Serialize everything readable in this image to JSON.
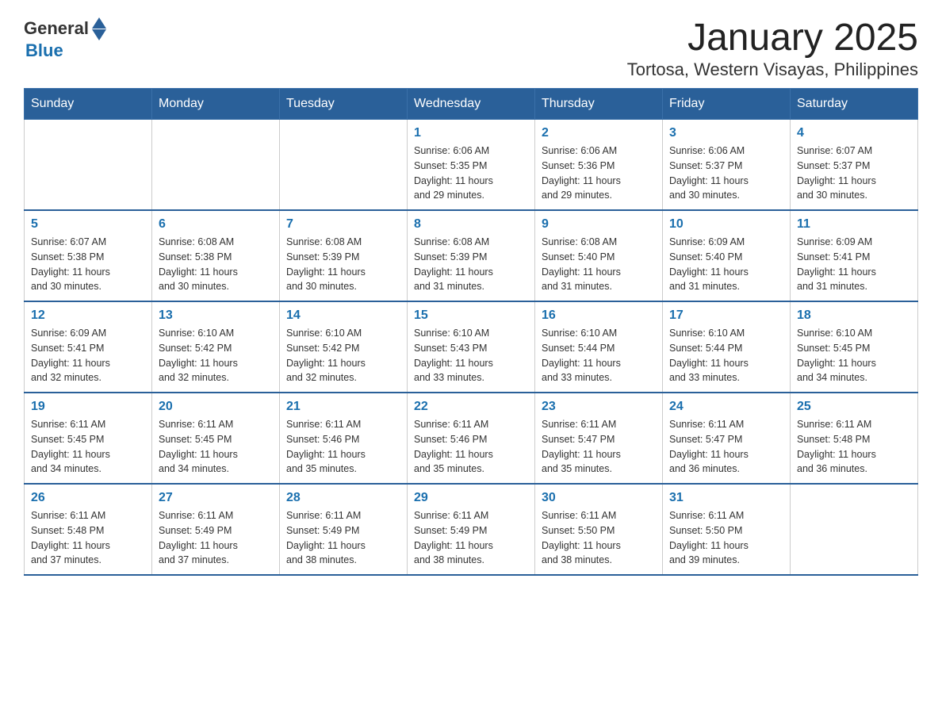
{
  "logo": {
    "text_general": "General",
    "text_blue": "Blue"
  },
  "title": "January 2025",
  "subtitle": "Tortosa, Western Visayas, Philippines",
  "headers": [
    "Sunday",
    "Monday",
    "Tuesday",
    "Wednesday",
    "Thursday",
    "Friday",
    "Saturday"
  ],
  "weeks": [
    [
      {
        "day": "",
        "info": ""
      },
      {
        "day": "",
        "info": ""
      },
      {
        "day": "",
        "info": ""
      },
      {
        "day": "1",
        "info": "Sunrise: 6:06 AM\nSunset: 5:35 PM\nDaylight: 11 hours\nand 29 minutes."
      },
      {
        "day": "2",
        "info": "Sunrise: 6:06 AM\nSunset: 5:36 PM\nDaylight: 11 hours\nand 29 minutes."
      },
      {
        "day": "3",
        "info": "Sunrise: 6:06 AM\nSunset: 5:37 PM\nDaylight: 11 hours\nand 30 minutes."
      },
      {
        "day": "4",
        "info": "Sunrise: 6:07 AM\nSunset: 5:37 PM\nDaylight: 11 hours\nand 30 minutes."
      }
    ],
    [
      {
        "day": "5",
        "info": "Sunrise: 6:07 AM\nSunset: 5:38 PM\nDaylight: 11 hours\nand 30 minutes."
      },
      {
        "day": "6",
        "info": "Sunrise: 6:08 AM\nSunset: 5:38 PM\nDaylight: 11 hours\nand 30 minutes."
      },
      {
        "day": "7",
        "info": "Sunrise: 6:08 AM\nSunset: 5:39 PM\nDaylight: 11 hours\nand 30 minutes."
      },
      {
        "day": "8",
        "info": "Sunrise: 6:08 AM\nSunset: 5:39 PM\nDaylight: 11 hours\nand 31 minutes."
      },
      {
        "day": "9",
        "info": "Sunrise: 6:08 AM\nSunset: 5:40 PM\nDaylight: 11 hours\nand 31 minutes."
      },
      {
        "day": "10",
        "info": "Sunrise: 6:09 AM\nSunset: 5:40 PM\nDaylight: 11 hours\nand 31 minutes."
      },
      {
        "day": "11",
        "info": "Sunrise: 6:09 AM\nSunset: 5:41 PM\nDaylight: 11 hours\nand 31 minutes."
      }
    ],
    [
      {
        "day": "12",
        "info": "Sunrise: 6:09 AM\nSunset: 5:41 PM\nDaylight: 11 hours\nand 32 minutes."
      },
      {
        "day": "13",
        "info": "Sunrise: 6:10 AM\nSunset: 5:42 PM\nDaylight: 11 hours\nand 32 minutes."
      },
      {
        "day": "14",
        "info": "Sunrise: 6:10 AM\nSunset: 5:42 PM\nDaylight: 11 hours\nand 32 minutes."
      },
      {
        "day": "15",
        "info": "Sunrise: 6:10 AM\nSunset: 5:43 PM\nDaylight: 11 hours\nand 33 minutes."
      },
      {
        "day": "16",
        "info": "Sunrise: 6:10 AM\nSunset: 5:44 PM\nDaylight: 11 hours\nand 33 minutes."
      },
      {
        "day": "17",
        "info": "Sunrise: 6:10 AM\nSunset: 5:44 PM\nDaylight: 11 hours\nand 33 minutes."
      },
      {
        "day": "18",
        "info": "Sunrise: 6:10 AM\nSunset: 5:45 PM\nDaylight: 11 hours\nand 34 minutes."
      }
    ],
    [
      {
        "day": "19",
        "info": "Sunrise: 6:11 AM\nSunset: 5:45 PM\nDaylight: 11 hours\nand 34 minutes."
      },
      {
        "day": "20",
        "info": "Sunrise: 6:11 AM\nSunset: 5:45 PM\nDaylight: 11 hours\nand 34 minutes."
      },
      {
        "day": "21",
        "info": "Sunrise: 6:11 AM\nSunset: 5:46 PM\nDaylight: 11 hours\nand 35 minutes."
      },
      {
        "day": "22",
        "info": "Sunrise: 6:11 AM\nSunset: 5:46 PM\nDaylight: 11 hours\nand 35 minutes."
      },
      {
        "day": "23",
        "info": "Sunrise: 6:11 AM\nSunset: 5:47 PM\nDaylight: 11 hours\nand 35 minutes."
      },
      {
        "day": "24",
        "info": "Sunrise: 6:11 AM\nSunset: 5:47 PM\nDaylight: 11 hours\nand 36 minutes."
      },
      {
        "day": "25",
        "info": "Sunrise: 6:11 AM\nSunset: 5:48 PM\nDaylight: 11 hours\nand 36 minutes."
      }
    ],
    [
      {
        "day": "26",
        "info": "Sunrise: 6:11 AM\nSunset: 5:48 PM\nDaylight: 11 hours\nand 37 minutes."
      },
      {
        "day": "27",
        "info": "Sunrise: 6:11 AM\nSunset: 5:49 PM\nDaylight: 11 hours\nand 37 minutes."
      },
      {
        "day": "28",
        "info": "Sunrise: 6:11 AM\nSunset: 5:49 PM\nDaylight: 11 hours\nand 38 minutes."
      },
      {
        "day": "29",
        "info": "Sunrise: 6:11 AM\nSunset: 5:49 PM\nDaylight: 11 hours\nand 38 minutes."
      },
      {
        "day": "30",
        "info": "Sunrise: 6:11 AM\nSunset: 5:50 PM\nDaylight: 11 hours\nand 38 minutes."
      },
      {
        "day": "31",
        "info": "Sunrise: 6:11 AM\nSunset: 5:50 PM\nDaylight: 11 hours\nand 39 minutes."
      },
      {
        "day": "",
        "info": ""
      }
    ]
  ]
}
